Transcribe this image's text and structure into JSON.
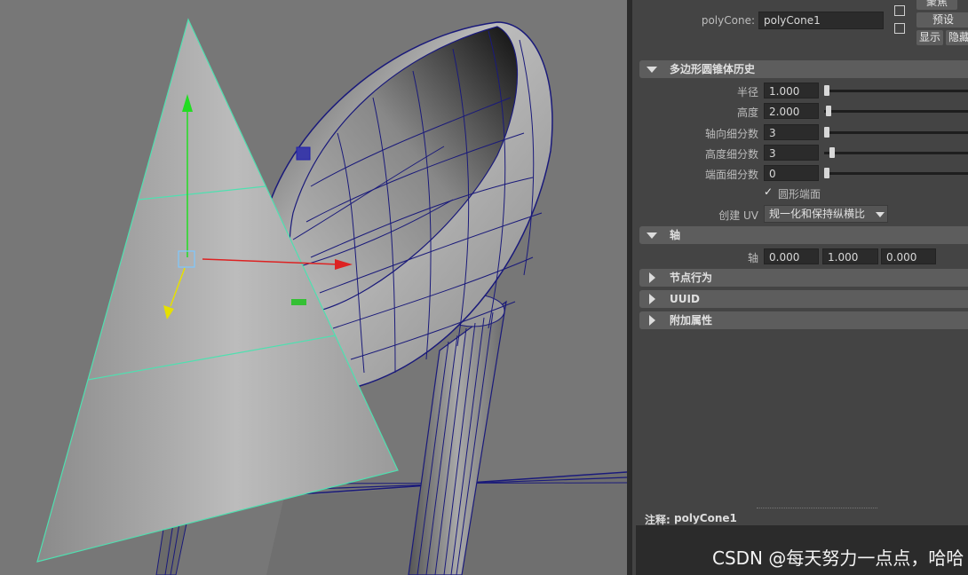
{
  "header": {
    "node_label": "polyCone:",
    "node_value": "polyCone1",
    "btn_focus": "聚焦",
    "btn_preset": "预设",
    "btn_show": "显示",
    "btn_hide": "隐藏"
  },
  "history_section": {
    "title": "多边形圆锥体历史",
    "rows": [
      {
        "label": "半径",
        "value": "1.000"
      },
      {
        "label": "高度",
        "value": "2.000"
      },
      {
        "label": "轴向细分数",
        "value": "3"
      },
      {
        "label": "高度细分数",
        "value": "3"
      },
      {
        "label": "端面细分数",
        "value": "0"
      }
    ],
    "checkbox_label": "圆形端面",
    "create_uv_label": "创建 UV",
    "create_uv_value": "规一化和保持纵横比"
  },
  "axis_section": {
    "title": "轴",
    "label": "轴",
    "values": [
      "0.000",
      "1.000",
      "0.000"
    ]
  },
  "collapsed_sections": [
    "节点行为",
    "UUID",
    "附加属性"
  ],
  "notes": {
    "label": "注释:",
    "value": "polyCone1"
  },
  "watermark": "CSDN @每天努力一点点，哈哈",
  "colors": {
    "viewport_bg": "#777777",
    "panel_bg": "#444444",
    "wire_blue": "#1a1a7a",
    "selection_green": "#4fe0b0",
    "axis_y": "#22dd22",
    "axis_x": "#dd2222",
    "axis_z": "#e6e000"
  }
}
